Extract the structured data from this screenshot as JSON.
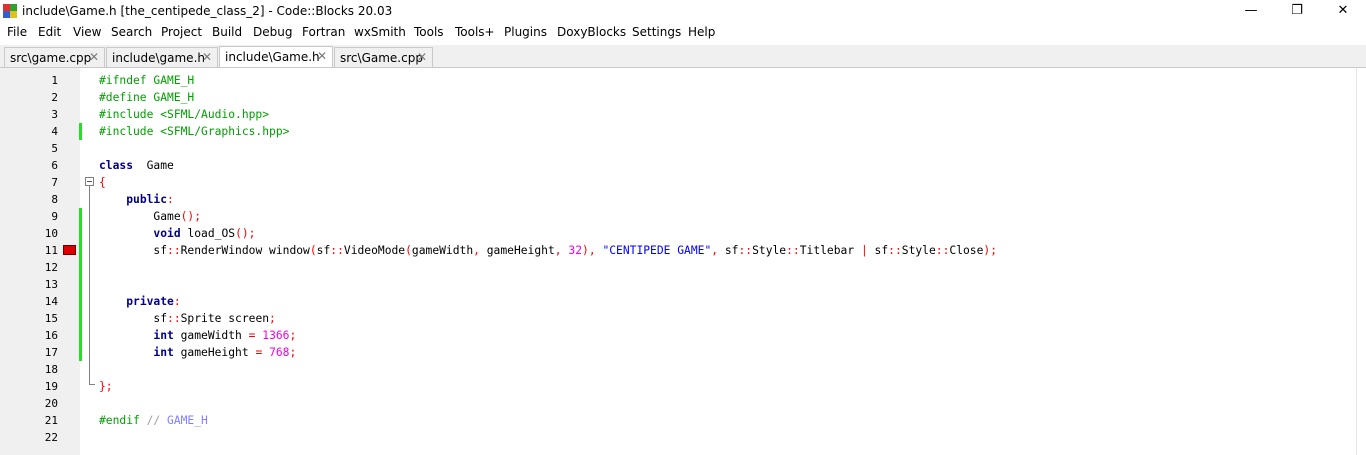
{
  "titlebar": {
    "title": "include\\Game.h [the_centipede_class_2] - Code::Blocks 20.03",
    "minimize": "—",
    "maximize": "❐",
    "close": "✕"
  },
  "menu": [
    "File",
    "Edit",
    "View",
    "Search",
    "Project",
    "Build",
    "Debug",
    "Fortran",
    "wxSmith",
    "Tools",
    "Tools+",
    "Plugins",
    "DoxyBlocks",
    "Settings",
    "Help"
  ],
  "tabs": [
    {
      "label": "src\\game.cpp",
      "active": false
    },
    {
      "label": "include\\game.h",
      "active": false
    },
    {
      "label": "include\\Game.h",
      "active": true
    },
    {
      "label": "src\\Game.cpp",
      "active": false
    }
  ],
  "tab_close_glyph": "✕",
  "editor": {
    "lines": [
      {
        "n": "1",
        "changed": false,
        "bp": false,
        "tokens": [
          [
            "pp",
            "#ifndef GAME_H"
          ]
        ]
      },
      {
        "n": "2",
        "changed": false,
        "bp": false,
        "tokens": [
          [
            "pp",
            "#define GAME_H"
          ]
        ]
      },
      {
        "n": "3",
        "changed": false,
        "bp": false,
        "tokens": [
          [
            "pp",
            "#include <SFML/Audio.hpp>"
          ]
        ]
      },
      {
        "n": "4",
        "changed": true,
        "bp": false,
        "tokens": [
          [
            "pp",
            "#include <SFML/Graphics.hpp>"
          ]
        ]
      },
      {
        "n": "5",
        "changed": false,
        "bp": false,
        "tokens": []
      },
      {
        "n": "6",
        "changed": false,
        "bp": false,
        "tokens": [
          [
            "kw",
            "class"
          ],
          [
            "",
            "  Game"
          ]
        ]
      },
      {
        "n": "7",
        "changed": false,
        "bp": false,
        "tokens": [
          [
            "op",
            "{"
          ]
        ]
      },
      {
        "n": "8",
        "changed": false,
        "bp": false,
        "tokens": [
          [
            "",
            "    "
          ],
          [
            "kw",
            "public"
          ],
          [
            "op",
            ":"
          ]
        ]
      },
      {
        "n": "9",
        "changed": true,
        "bp": false,
        "tokens": [
          [
            "",
            "        Game"
          ],
          [
            "op",
            "();"
          ]
        ]
      },
      {
        "n": "10",
        "changed": true,
        "bp": false,
        "tokens": [
          [
            "",
            "        "
          ],
          [
            "kw",
            "void"
          ],
          [
            "",
            " load_OS"
          ],
          [
            "op",
            "();"
          ]
        ]
      },
      {
        "n": "11",
        "changed": true,
        "bp": true,
        "tokens": [
          [
            "",
            "        sf"
          ],
          [
            "op",
            "::"
          ],
          [
            "",
            "RenderWindow window"
          ],
          [
            "op",
            "("
          ],
          [
            "",
            "sf"
          ],
          [
            "op",
            "::"
          ],
          [
            "",
            "VideoMode"
          ],
          [
            "op",
            "("
          ],
          [
            "",
            "gameWidth"
          ],
          [
            "op",
            ","
          ],
          [
            "",
            " gameHeight"
          ],
          [
            "op",
            ","
          ],
          [
            "",
            " "
          ],
          [
            "num",
            "32"
          ],
          [
            "op",
            "),"
          ],
          [
            "",
            " "
          ],
          [
            "str",
            "\"CENTIPEDE GAME\""
          ],
          [
            "op",
            ","
          ],
          [
            "",
            " sf"
          ],
          [
            "op",
            "::"
          ],
          [
            "",
            "Style"
          ],
          [
            "op",
            "::"
          ],
          [
            "",
            "Titlebar "
          ],
          [
            "op",
            "|"
          ],
          [
            "",
            " sf"
          ],
          [
            "op",
            "::"
          ],
          [
            "",
            "Style"
          ],
          [
            "op",
            "::"
          ],
          [
            "",
            "Close"
          ],
          [
            "op",
            ");"
          ]
        ]
      },
      {
        "n": "12",
        "changed": true,
        "bp": false,
        "tokens": []
      },
      {
        "n": "13",
        "changed": true,
        "bp": false,
        "tokens": []
      },
      {
        "n": "14",
        "changed": true,
        "bp": false,
        "tokens": [
          [
            "",
            "    "
          ],
          [
            "kw",
            "private"
          ],
          [
            "op",
            ":"
          ]
        ]
      },
      {
        "n": "15",
        "changed": true,
        "bp": false,
        "tokens": [
          [
            "",
            "        sf"
          ],
          [
            "op",
            "::"
          ],
          [
            "",
            "Sprite screen"
          ],
          [
            "op",
            ";"
          ]
        ]
      },
      {
        "n": "16",
        "changed": true,
        "bp": false,
        "tokens": [
          [
            "",
            "        "
          ],
          [
            "kw",
            "int"
          ],
          [
            "",
            " gameWidth "
          ],
          [
            "op",
            "="
          ],
          [
            "",
            " "
          ],
          [
            "num",
            "1366"
          ],
          [
            "op",
            ";"
          ]
        ]
      },
      {
        "n": "17",
        "changed": true,
        "bp": false,
        "tokens": [
          [
            "",
            "        "
          ],
          [
            "kw",
            "int"
          ],
          [
            "",
            " gameHeight "
          ],
          [
            "op",
            "="
          ],
          [
            "",
            " "
          ],
          [
            "num",
            "768"
          ],
          [
            "op",
            ";"
          ]
        ]
      },
      {
        "n": "18",
        "changed": false,
        "bp": false,
        "tokens": []
      },
      {
        "n": "19",
        "changed": false,
        "bp": false,
        "tokens": [
          [
            "op",
            "};"
          ]
        ]
      },
      {
        "n": "20",
        "changed": false,
        "bp": false,
        "tokens": []
      },
      {
        "n": "21",
        "changed": false,
        "bp": false,
        "tokens": [
          [
            "pp",
            "#endif"
          ],
          [
            "",
            " "
          ],
          [
            "cm",
            "// "
          ],
          [
            "cmk",
            "GAME_H"
          ]
        ]
      },
      {
        "n": "22",
        "changed": false,
        "bp": false,
        "tokens": []
      }
    ]
  }
}
